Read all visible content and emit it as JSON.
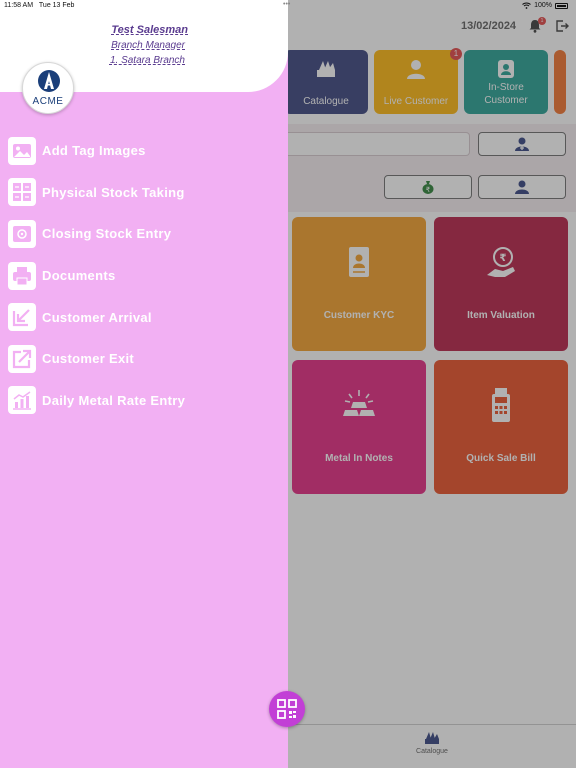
{
  "status_bar": {
    "time": "11:58 AM",
    "date": "Tue 13 Feb",
    "battery": "100%"
  },
  "drawer": {
    "user": {
      "name": "Test  Salesman",
      "role": "Branch Manager",
      "branch": "1. Satara Branch"
    },
    "logo_text": "ACME",
    "menu": [
      {
        "label": "Add Tag Images",
        "icon": "image-icon"
      },
      {
        "label": "Physical Stock Taking",
        "icon": "stock-grid-icon"
      },
      {
        "label": "Closing Stock Entry",
        "icon": "safe-icon"
      },
      {
        "label": "Documents",
        "icon": "printer-icon"
      },
      {
        "label": "Customer Arrival",
        "icon": "arrow-in-icon"
      },
      {
        "label": "Customer Exit",
        "icon": "arrow-out-icon"
      },
      {
        "label": "Daily Metal Rate Entry",
        "icon": "chart-icon"
      }
    ]
  },
  "header": {
    "date": "13/02/2024",
    "notification_count": "1"
  },
  "quick_tiles": [
    {
      "label": "Catalogue",
      "color": "#303a78"
    },
    {
      "label": "Live Customer",
      "color": "#ffb400",
      "badge": "1"
    },
    {
      "label": "In-Store Customer",
      "color": "#1b9c8e"
    }
  ],
  "cards": [
    {
      "label": "Customer KYC",
      "color": "#f39a1e"
    },
    {
      "label": "Item Valuation",
      "color": "#b3143d"
    },
    {
      "label": "Metal In Notes",
      "color": "#e41c7a"
    },
    {
      "label": "Quick Sale Bill",
      "color": "#e8461a"
    }
  ],
  "tabbar": {
    "catalogue_label": "Catalogue"
  },
  "colors": {
    "drawer_bg": "#f2b0f3",
    "accent": "#5a3b8f",
    "fab": "#c23fd6"
  }
}
